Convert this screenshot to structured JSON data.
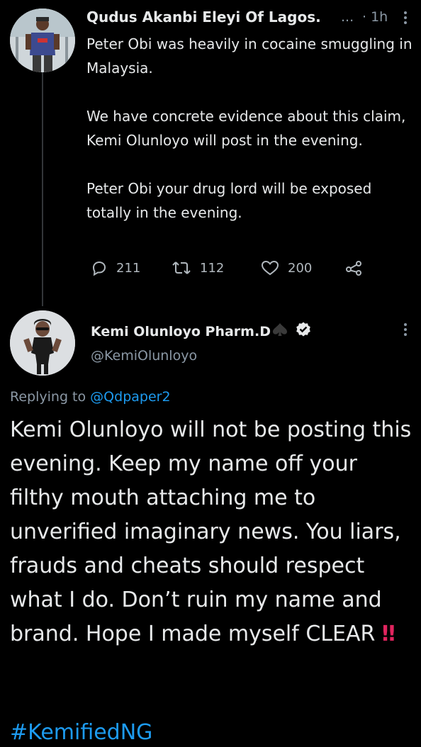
{
  "tweet1": {
    "author_name": "Qudus Akanbi Eleyi Of Lagos.",
    "ellipsis": "...",
    "time": "· 1h",
    "paragraphs": [
      "Peter Obi was heavily in cocaine smuggling in Malaysia.",
      "We have concrete evidence about this claim, Kemi Olunloyo will post in the evening.",
      "Peter Obi your drug lord will be exposed totally in the evening."
    ],
    "replies": "211",
    "retweets": "112",
    "likes": "200"
  },
  "tweet2": {
    "author_name": "Kemi Olunloyo Pharm.D",
    "handle": "@KemiOlunloyo",
    "replying_prefix": "Replying to",
    "replying_to": "@Qdpaper2",
    "body": "Kemi Olunloyo will not be posting this evening. Keep my name off your filthy mouth attaching me to unverified imaginary news. You liars, frauds and cheats should respect what I do. Don’t ruin my name and brand. Hope I made myself CLEAR",
    "emphasis_emoji": "‼",
    "hashtag": "#KemifiedNG"
  },
  "icons": {
    "reply": "reply-icon",
    "retweet": "retweet-icon",
    "like": "heart-icon",
    "share": "share-icon",
    "verified": "verified-badge-icon",
    "more": "more-vertical-icon",
    "spade": "spade-icon"
  },
  "colors": {
    "background": "#000000",
    "text": "#e7e9ea",
    "muted": "#8b98a5",
    "link": "#1d9bf0",
    "emoji_red": "#e0245e"
  }
}
